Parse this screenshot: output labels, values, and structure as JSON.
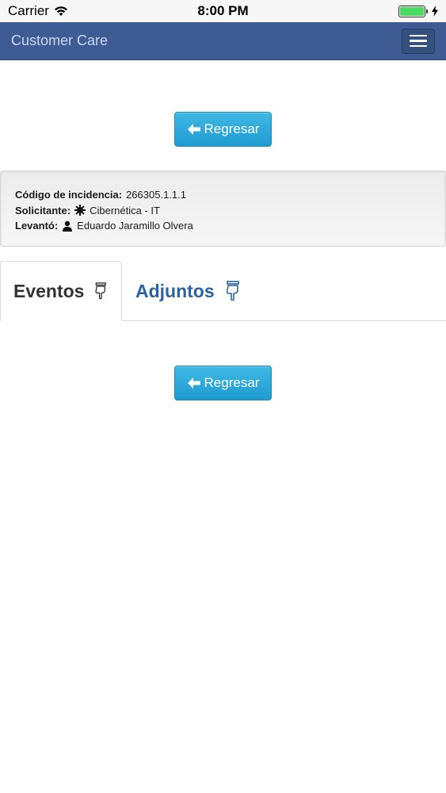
{
  "status_bar": {
    "carrier": "Carrier",
    "time": "8:00 PM",
    "battery_level": 1.0
  },
  "navbar": {
    "title": "Customer Care",
    "menu_icon": "hamburger-icon"
  },
  "buttons": {
    "back_label": "Regresar",
    "back_icon": "arrow-left-icon"
  },
  "incident": {
    "code_label": "Código de incidencia:",
    "code_value": "266305.1.1.1",
    "requester_label": "Solicitante:",
    "requester_icon": "gear-icon",
    "requester_value": "Cibernética - IT",
    "raised_by_label": "Levantó:",
    "raised_by_icon": "user-icon",
    "raised_by_value": "Eduardo Jaramillo Olvera"
  },
  "tabs": [
    {
      "label": "Eventos",
      "icon": "hand-pointing-down-icon",
      "active": true
    },
    {
      "label": "Adjuntos",
      "icon": "hand-pointing-down-icon",
      "active": false
    }
  ],
  "colors": {
    "navbar": "#3e5c93",
    "button": "#27a6da",
    "tab_link": "#2b62a2"
  }
}
